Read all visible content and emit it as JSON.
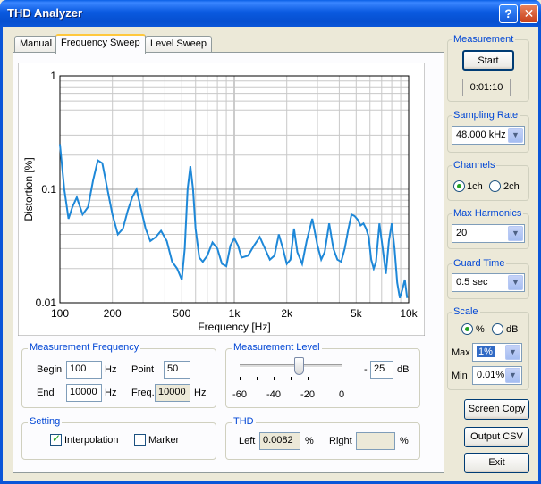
{
  "window": {
    "title": "THD Analyzer",
    "help_glyph": "?",
    "close_glyph": "✕"
  },
  "tabs": [
    {
      "label": "Manual"
    },
    {
      "label": "Frequency Sweep"
    },
    {
      "label": "Level Sweep"
    }
  ],
  "chart_data": {
    "type": "line",
    "xlabel": "Frequency [Hz]",
    "ylabel": "Distortion [%]",
    "x_scale": "log",
    "y_scale": "log",
    "xlim": [
      100,
      10000
    ],
    "ylim": [
      0.01,
      1
    ],
    "x_ticks": [
      "100",
      "200",
      "500",
      "1k",
      "2k",
      "5k",
      "10k"
    ],
    "y_ticks": [
      "1",
      "0.1",
      "0.01"
    ],
    "grid": true,
    "line_color": "#1e88d8",
    "x": [
      100,
      106,
      112,
      118,
      125,
      135,
      145,
      155,
      165,
      175,
      185,
      200,
      215,
      230,
      245,
      260,
      275,
      290,
      310,
      330,
      355,
      380,
      410,
      440,
      470,
      500,
      520,
      540,
      560,
      580,
      600,
      630,
      660,
      700,
      750,
      800,
      850,
      900,
      950,
      1000,
      1050,
      1100,
      1200,
      1300,
      1400,
      1500,
      1600,
      1700,
      1800,
      1900,
      2000,
      2100,
      2200,
      2300,
      2450,
      2600,
      2800,
      3000,
      3150,
      3300,
      3500,
      3700,
      3900,
      4100,
      4300,
      4500,
      4700,
      4900,
      5100,
      5300,
      5500,
      5700,
      5900,
      6100,
      6300,
      6500,
      6800,
      7100,
      7400,
      7700,
      8000,
      8300,
      8600,
      8900,
      9200,
      9500,
      9800
    ],
    "values": [
      0.25,
      0.1,
      0.055,
      0.07,
      0.085,
      0.06,
      0.07,
      0.12,
      0.18,
      0.17,
      0.11,
      0.06,
      0.04,
      0.045,
      0.065,
      0.085,
      0.1,
      0.07,
      0.045,
      0.035,
      0.038,
      0.043,
      0.035,
      0.023,
      0.02,
      0.016,
      0.03,
      0.1,
      0.16,
      0.1,
      0.045,
      0.025,
      0.023,
      0.026,
      0.034,
      0.03,
      0.022,
      0.021,
      0.032,
      0.037,
      0.032,
      0.025,
      0.026,
      0.032,
      0.038,
      0.03,
      0.024,
      0.026,
      0.04,
      0.03,
      0.022,
      0.024,
      0.045,
      0.028,
      0.022,
      0.035,
      0.055,
      0.032,
      0.024,
      0.028,
      0.05,
      0.03,
      0.024,
      0.023,
      0.03,
      0.044,
      0.06,
      0.058,
      0.054,
      0.048,
      0.05,
      0.045,
      0.038,
      0.024,
      0.02,
      0.023,
      0.05,
      0.03,
      0.018,
      0.035,
      0.05,
      0.03,
      0.015,
      0.011,
      0.013,
      0.016,
      0.011
    ]
  },
  "measurement_frequency": {
    "label": "Measurement Frequency",
    "begin_label": "Begin",
    "begin": "100",
    "begin_unit": "Hz",
    "end_label": "End",
    "end": "10000",
    "end_unit": "Hz",
    "point_label": "Point",
    "point": "50",
    "freq_label": "Freq.",
    "freq": "10000",
    "freq_unit": "Hz"
  },
  "measurement_level": {
    "label": "Measurement Level",
    "slider_value": -25,
    "slider_min": -60,
    "slider_max": 0,
    "ticks": [
      "-60",
      "-40",
      "-20",
      "0"
    ],
    "sign": "-",
    "value": "25",
    "unit": "dB"
  },
  "setting": {
    "label": "Setting",
    "interpolation_label": "Interpolation",
    "interpolation": true,
    "marker_label": "Marker",
    "marker": false
  },
  "thd": {
    "label": "THD",
    "left_label": "Left",
    "left": "0.0082",
    "left_unit": "%",
    "right_label": "Right",
    "right": "",
    "right_unit": "%"
  },
  "measurement": {
    "label": "Measurement",
    "start_label": "Start",
    "elapsed": "0:01:10"
  },
  "sampling_rate": {
    "label": "Sampling Rate",
    "value": "48.000 kHz"
  },
  "channels": {
    "label": "Channels",
    "opt1": "1ch",
    "opt2": "2ch",
    "selected": "1ch"
  },
  "max_harmonics": {
    "label": "Max Harmonics",
    "value": "20"
  },
  "guard_time": {
    "label": "Guard Time",
    "value": "0.5 sec"
  },
  "scale": {
    "label": "Scale",
    "opt_pct": "%",
    "opt_db": "dB",
    "selected": "%",
    "max_label": "Max",
    "max": "1%",
    "min_label": "Min",
    "min": "0.01%"
  },
  "buttons": {
    "screen_copy": "Screen Copy",
    "output_csv": "Output CSV",
    "exit": "Exit"
  },
  "glyphs": {
    "dropdown": "▼"
  }
}
